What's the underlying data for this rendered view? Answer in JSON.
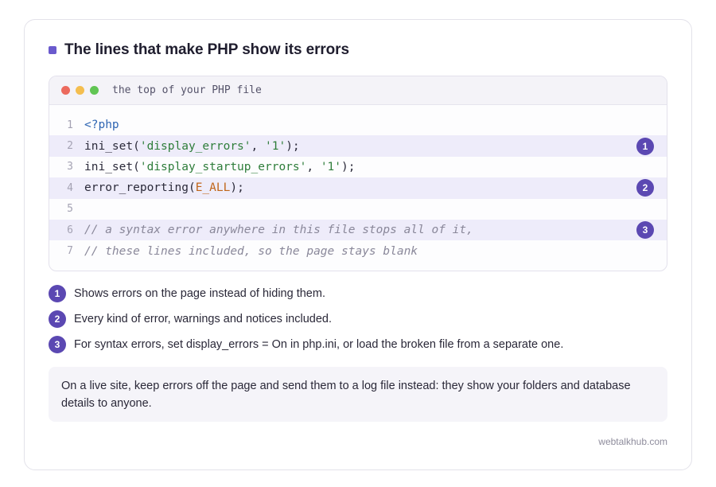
{
  "title": "The lines that make PHP show its errors",
  "code": {
    "filename": "the top of your PHP file",
    "lines": [
      {
        "num": "1",
        "text": "<?php",
        "badge": ""
      },
      {
        "num": "2",
        "text": "ini_set('display_errors', '1');",
        "badge": "1"
      },
      {
        "num": "3",
        "text": "ini_set('display_startup_errors', '1');",
        "badge": ""
      },
      {
        "num": "4",
        "text": "error_reporting(E_ALL);",
        "badge": "2"
      },
      {
        "num": "5",
        "text": "",
        "badge": ""
      },
      {
        "num": "6",
        "text": "// a syntax error anywhere in this file stops all of it,",
        "badge": "3"
      },
      {
        "num": "7",
        "text": "// these lines included, so the page stays blank",
        "badge": ""
      }
    ]
  },
  "notes": [
    {
      "badge": "1",
      "text": "Shows errors on the page instead of hiding them."
    },
    {
      "badge": "2",
      "text": "Every kind of error, warnings and notices included."
    },
    {
      "badge": "3",
      "text": "For syntax errors, set display_errors = On in php.ini, or load the broken file from a separate one."
    }
  ],
  "callout": "On a live site, keep errors off the page and send them to a log file instead: they show your folders and database details to anyone.",
  "footer": "webtalkhub.com",
  "colors": {
    "accent": "#5b48b2",
    "highlight": "#eeecfa",
    "string": "#2e7d3a",
    "constant": "#c0651a",
    "tag": "#2f66b3"
  }
}
